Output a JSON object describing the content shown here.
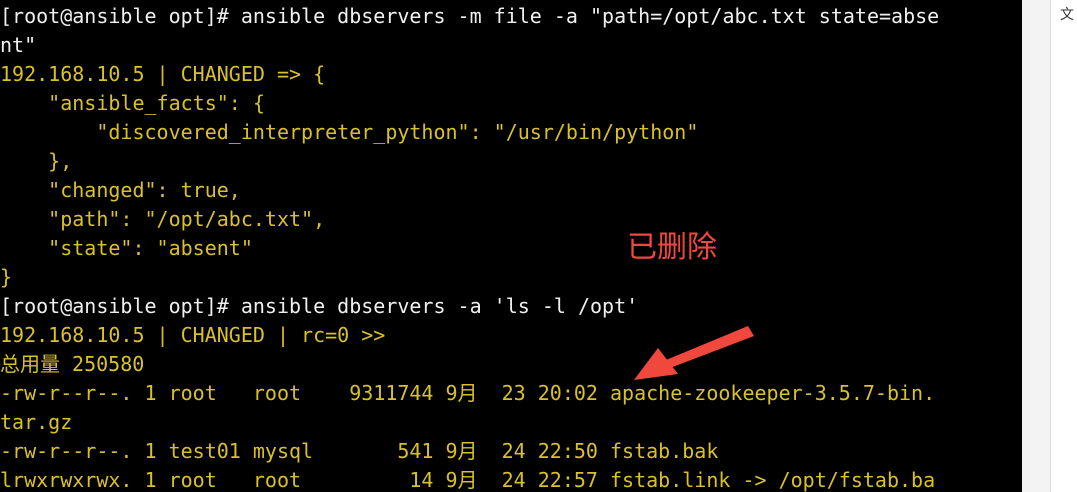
{
  "terminal": {
    "lines": [
      "[root@ansible opt]# ansible dbservers -m file -a \"path=/opt/abc.txt state=abse",
      "nt\"",
      "192.168.10.5 | CHANGED => {",
      "    \"ansible_facts\": {",
      "        \"discovered_interpreter_python\": \"/usr/bin/python\"",
      "    },",
      "    \"changed\": true,",
      "    \"path\": \"/opt/abc.txt\",",
      "    \"state\": \"absent\"",
      "}",
      "[root@ansible opt]# ansible dbservers -a 'ls -l /opt'",
      "192.168.10.5 | CHANGED | rc=0 >>",
      "总用量 250580",
      "-rw-r--r--. 1 root   root    9311744 9月  23 20:02 apache-zookeeper-3.5.7-bin.",
      "tar.gz",
      "-rw-r--r--. 1 test01 mysql       541 9月  24 22:50 fstab.bak",
      "lrwxrwxrwx. 1 root   root         14 9月  24 22:57 fstab.link -> /opt/fstab.ba"
    ],
    "line_colors": [
      "white",
      "white",
      "yellow",
      "yellow",
      "yellow",
      "yellow",
      "yellow",
      "yellow",
      "yellow",
      "yellow",
      "white",
      "yellow",
      "yellow",
      "yellow",
      "yellow",
      "yellow",
      "yellow"
    ]
  },
  "annotation": {
    "text": "已删除",
    "color": "#f0483c",
    "arrow_icon": "red-arrow-icon"
  },
  "side_panel": {
    "label": "文"
  }
}
